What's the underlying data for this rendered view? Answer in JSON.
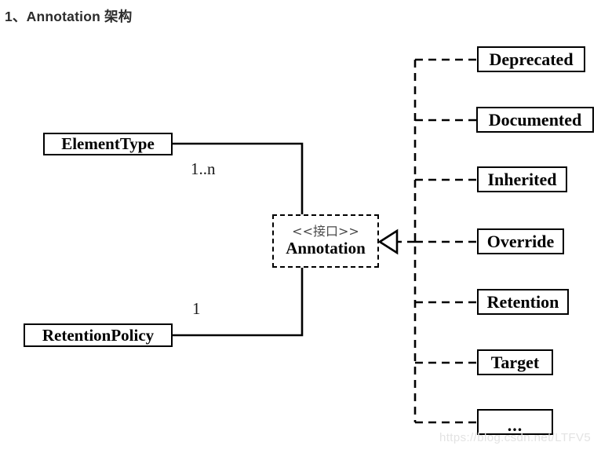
{
  "page": {
    "title": "1、Annotation 架构",
    "watermark": "https://blog.csdn.net/LTFV5",
    "background_color": "#ffffff",
    "line_color": "#000000",
    "title_color": "#2b2b2b",
    "watermark_color": "#e3e3e3"
  },
  "diagram": {
    "type": "uml-class-diagram",
    "interface": {
      "stereotype": "<<接口>>",
      "name": "Annotation",
      "border_style": "dashed"
    },
    "associations": [
      {
        "name": "ElementType",
        "multiplicity": "1..n",
        "line_style": "solid",
        "target": "Annotation"
      },
      {
        "name": "RetentionPolicy",
        "multiplicity": "1",
        "line_style": "solid",
        "target": "Annotation"
      }
    ],
    "implementations": {
      "relation": "realization",
      "arrow": "hollow-triangle",
      "line_style": "dashed",
      "items": [
        {
          "name": "Deprecated"
        },
        {
          "name": "Documented"
        },
        {
          "name": "Inherited"
        },
        {
          "name": "Override"
        },
        {
          "name": "Retention"
        },
        {
          "name": "Target"
        },
        {
          "name": "..."
        }
      ]
    }
  }
}
